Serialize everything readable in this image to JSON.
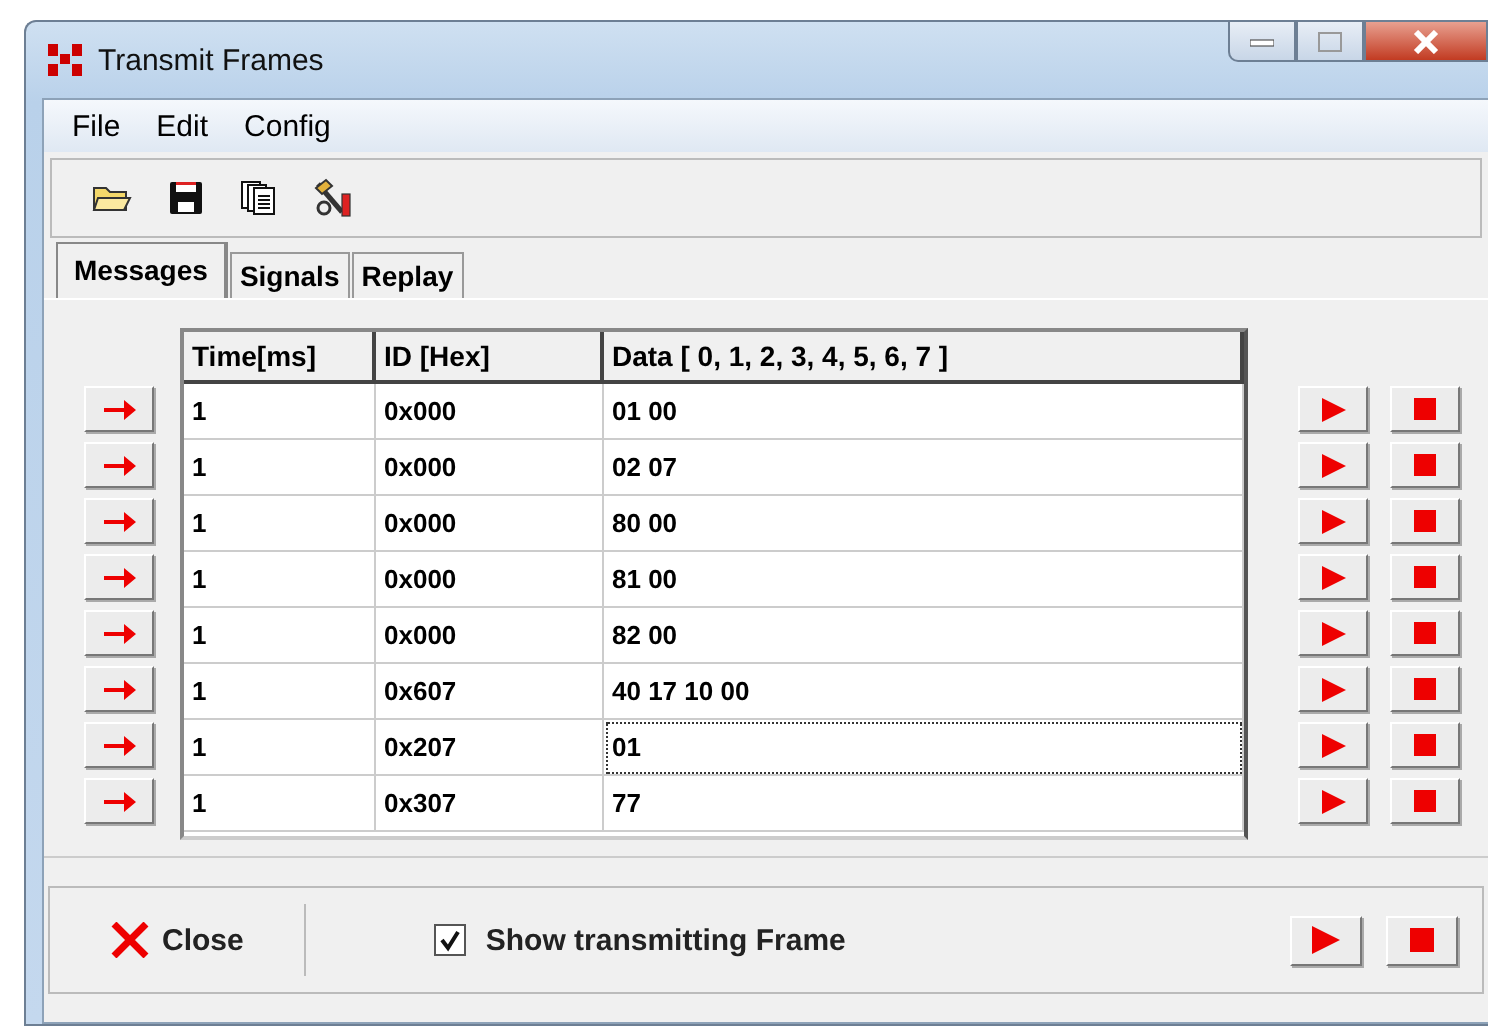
{
  "window": {
    "title": "Transmit Frames"
  },
  "menu": [
    "File",
    "Edit",
    "Config"
  ],
  "tabs": [
    {
      "label": "Messages",
      "selected": true
    },
    {
      "label": "Signals",
      "selected": false
    },
    {
      "label": "Replay",
      "selected": false
    }
  ],
  "table": {
    "columns": [
      "Time[ms]",
      "ID [Hex]",
      "Data [ 0,  1,  2,  3,  4,  5,  6,  7 ]"
    ],
    "rows": [
      {
        "cells": [
          "1",
          "0x000",
          "01 00"
        ],
        "focused": false
      },
      {
        "cells": [
          "1",
          "0x000",
          "02 07"
        ],
        "focused": false
      },
      {
        "cells": [
          "1",
          "0x000",
          "80 00"
        ],
        "focused": false
      },
      {
        "cells": [
          "1",
          "0x000",
          "81 00"
        ],
        "focused": false
      },
      {
        "cells": [
          "1",
          "0x000",
          "82 00"
        ],
        "focused": false
      },
      {
        "cells": [
          "1",
          "0x607",
          "40 17 10 00"
        ],
        "focused": false
      },
      {
        "cells": [
          "1",
          "0x207",
          "01"
        ],
        "focused": true
      },
      {
        "cells": [
          "1",
          "0x307",
          "77"
        ],
        "focused": false
      }
    ]
  },
  "footer": {
    "close_label": "Close",
    "show_frame": {
      "label": "Show transmitting Frame",
      "checked": true
    }
  }
}
